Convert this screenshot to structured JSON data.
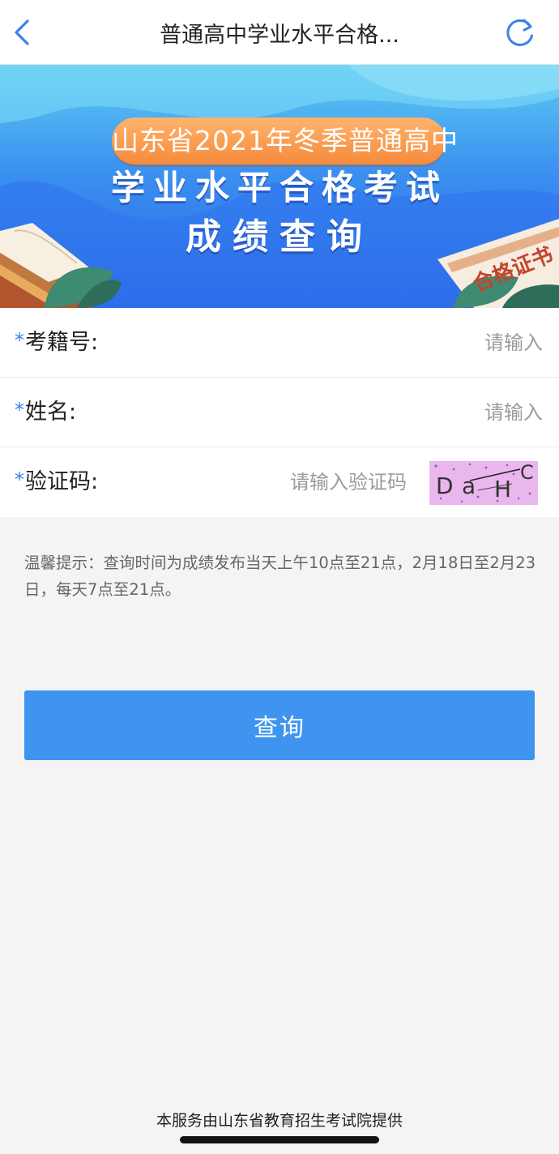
{
  "navbar": {
    "title": "普通高中学业水平合格...",
    "back_icon": "chevron-left-icon",
    "refresh_icon": "refresh-icon",
    "accent": "#3b82e8"
  },
  "banner": {
    "pill_text": "山东省2021年冬季普通高中",
    "line1": "学业水平合格考试",
    "line2": "成绩查询",
    "certificate_text": "合格证书"
  },
  "form": {
    "exam_id": {
      "label": "考籍号:",
      "placeholder": "请输入",
      "value": ""
    },
    "name": {
      "label": "姓名:",
      "placeholder": "请输入",
      "value": ""
    },
    "captcha": {
      "label": "验证码:",
      "placeholder": "请输入验证码",
      "value": "",
      "code_chars": [
        "D",
        "a",
        "H",
        "C"
      ]
    },
    "required_mark": "*"
  },
  "tip": "温馨提示：查询时间为成绩发布当天上午10点至21点，2月18日至2月23日，每天7点至21点。",
  "query_button": {
    "label": "查询",
    "color": "#3f94f0"
  },
  "footer": {
    "text": "本服务由山东省教育招生考试院提供"
  }
}
